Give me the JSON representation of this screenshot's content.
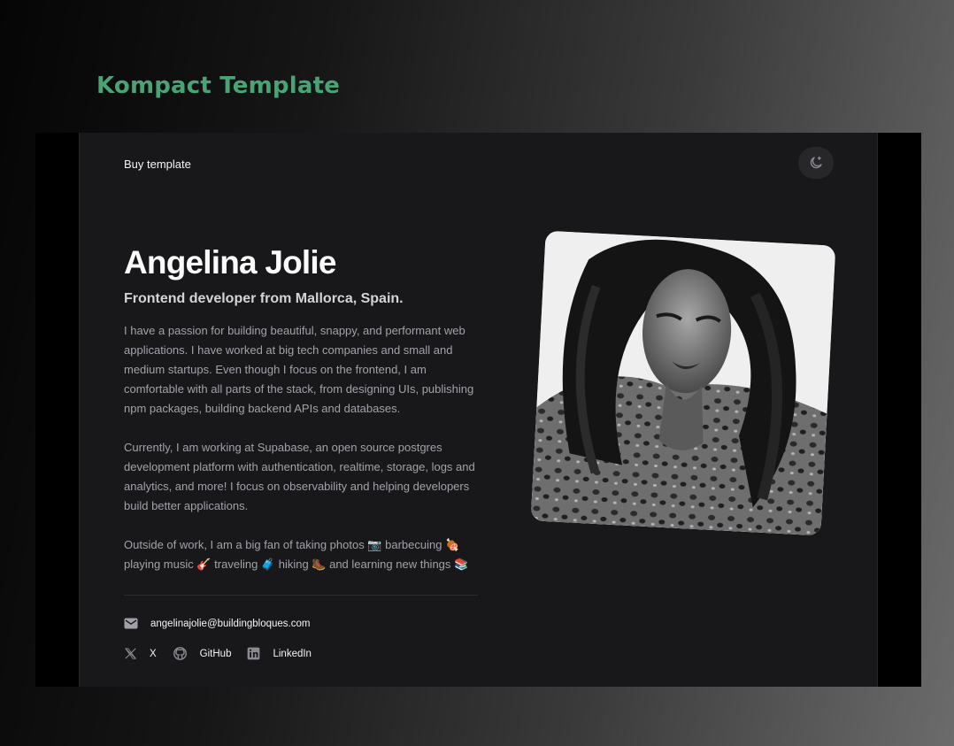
{
  "header": {
    "title": "Kompact Template"
  },
  "nav": {
    "buy_label": "Buy template",
    "theme_toggle_icon": "moon-sparkle-icon"
  },
  "profile": {
    "name": "Angelina Jolie",
    "tagline": "Frontend developer from Mallorca, Spain.",
    "bio": [
      "I have a passion for building beautiful, snappy, and performant web applications. I have worked at big tech companies and small and medium startups. Even though I focus on the frontend, I am comfortable with all parts of the stack, from designing UIs, publishing npm packages, building backend APIs and databases.",
      "Currently, I am working at Supabase, an open source postgres development platform with authentication, realtime, storage, logs and analytics, and more! I focus on observability and helping developers build better applications.",
      "Outside of work, I am a big fan of taking photos 📷 barbecuing 🍖 playing music 🎸 traveling 🧳 hiking 🥾 and learning new things 📚"
    ]
  },
  "contact": {
    "email": "angelinajolie@buildingbloques.com",
    "email_icon": "mail-icon"
  },
  "social": {
    "x_label": "X",
    "github_label": "GitHub",
    "linkedin_label": "LinkedIn"
  },
  "colors": {
    "accent": "#4aa377",
    "site_bg": "#18181b",
    "text_primary": "#fafafa",
    "text_muted": "#a1a1aa"
  }
}
